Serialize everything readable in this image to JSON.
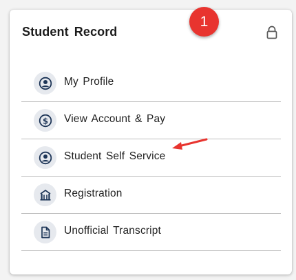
{
  "card": {
    "title": "Student Record",
    "lock_icon": "lock-icon"
  },
  "annotation": {
    "badge_number": "1",
    "badge_color": "#e8342f",
    "arrow_color": "#e8342f",
    "arrow_points_to": "Student Self Service"
  },
  "menu": {
    "items": [
      {
        "label": "My Profile",
        "icon": "user-circle-icon"
      },
      {
        "label": "View Account & Pay",
        "icon": "dollar-circle-icon"
      },
      {
        "label": "Student Self Service",
        "icon": "user-circle-icon"
      },
      {
        "label": "Registration",
        "icon": "building-icon"
      },
      {
        "label": "Unofficial Transcript",
        "icon": "document-icon"
      }
    ]
  },
  "colors": {
    "icon_color": "#1d3557",
    "icon_background": "#e6e9ee",
    "divider": "#bdbdbd"
  }
}
